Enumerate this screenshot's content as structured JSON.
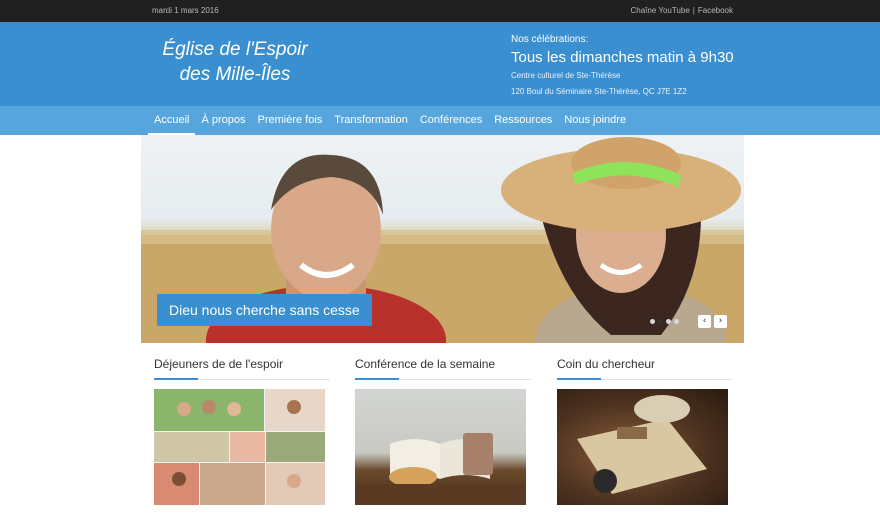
{
  "topbar": {
    "date": "mardi 1 mars 2016",
    "youtube": "Chaîne YouTube",
    "separator": "|",
    "facebook": "Facebook"
  },
  "header": {
    "logo_line1": "Église de l'Espoir",
    "logo_line2": "des Mille-Îles",
    "celebrations_label": "Nos célébrations:",
    "celebrations_time": "Tous les dimanches matin à 9h30",
    "venue": "Centre culturel de Ste-Thérèse",
    "address": "120 Boul du Séminaire Ste-Thérèse, QC J7E 1Z2"
  },
  "nav": {
    "items": [
      "Accueil",
      "À propos",
      "Première fois",
      "Transformation",
      "Conférences",
      "Ressources",
      "Nous joindre"
    ],
    "active": "Accueil"
  },
  "hero": {
    "caption": "Dieu nous cherche sans cesse",
    "slide_count": 4,
    "active_slide": 2,
    "prev_icon": "‹",
    "next_icon": "›"
  },
  "columns": [
    {
      "title": "Déjeuners de de l'espoir"
    },
    {
      "title": "Conférence de la semaine"
    },
    {
      "title": "Coin du chercheur"
    }
  ],
  "colors": {
    "accent": "#3a8fd0",
    "nav": "#56a6dd",
    "topbar": "#202020"
  }
}
